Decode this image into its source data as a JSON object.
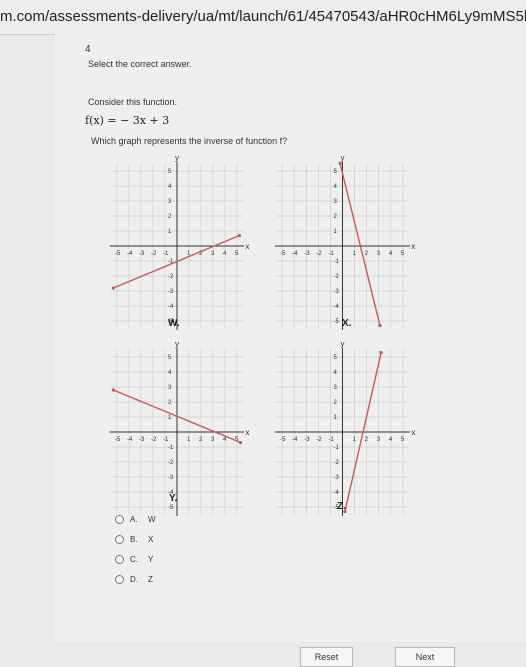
{
  "browser": {
    "url": "m.com/assessments-delivery/ua/mt/launch/61/45470543/aHR0cHM6Ly9mMS5hcHB"
  },
  "question": {
    "number": "4",
    "instruction": "Select the correct answer.",
    "prompt": "Consider this function.",
    "function": "f(x) = − 3x + 3",
    "question": "Which graph represents the inverse of function f?"
  },
  "graphs": {
    "axis_ticks": [
      "-5",
      "-4",
      "-3",
      "-2",
      "-1",
      "1",
      "2",
      "3",
      "4",
      "5"
    ],
    "y_label": "y",
    "x_label": "x",
    "labels": {
      "W": "W.",
      "X": "X.",
      "Y": "Y.",
      "Z": "Z."
    }
  },
  "options": [
    {
      "letter": "A.",
      "text": "W"
    },
    {
      "letter": "B.",
      "text": "X"
    },
    {
      "letter": "C.",
      "text": "Y"
    },
    {
      "letter": "D.",
      "text": "Z"
    }
  ],
  "buttons": {
    "reset": "Reset",
    "next": "Next"
  },
  "colors": {
    "line": "#c45a5a",
    "grid": "#cdcdcd",
    "axis": "#333333"
  }
}
